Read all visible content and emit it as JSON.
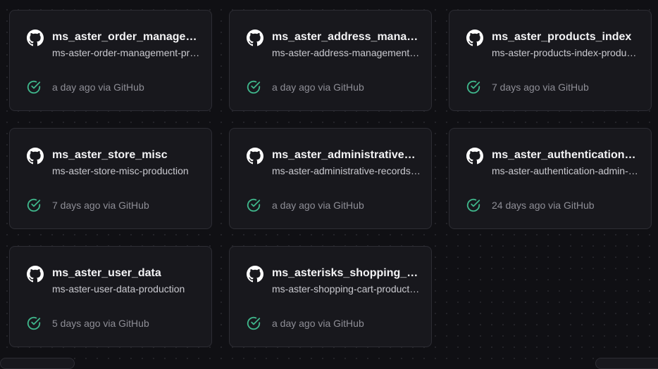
{
  "colors": {
    "background": "#101014",
    "card": "#18181d",
    "card_border": "#2d2d34",
    "title": "#f3f3f5",
    "description": "#c9c9cf",
    "status_text": "#8e8e96",
    "success": "#3fb68b"
  },
  "icons": {
    "source": "github-icon",
    "status": "check-circle-icon"
  },
  "projects": [
    {
      "name": "ms_aster_order_management",
      "description": "ms-aster-order-management-production",
      "status": "a day ago via GitHub"
    },
    {
      "name": "ms_aster_address_management",
      "description": "ms-aster-address-management-production",
      "status": "a day ago via GitHub"
    },
    {
      "name": "ms_aster_products_index",
      "description": "ms-aster-products-index-production",
      "status": "7 days ago via GitHub"
    },
    {
      "name": "ms_aster_store_misc",
      "description": "ms-aster-store-misc-production",
      "status": "7 days ago via GitHub"
    },
    {
      "name": "ms_aster_administrative_records",
      "description": "ms-aster-administrative-records-production",
      "status": "a day ago via GitHub"
    },
    {
      "name": "ms_aster_authentication_admin",
      "description": "ms-aster-authentication-admin-production",
      "status": "24 days ago via GitHub"
    },
    {
      "name": "ms_aster_user_data",
      "description": "ms-aster-user-data-production",
      "status": "5 days ago via GitHub"
    },
    {
      "name": "ms_asterisks_shopping_cart",
      "description": "ms-aster-shopping-cart-production",
      "status": "a day ago via GitHub"
    }
  ]
}
